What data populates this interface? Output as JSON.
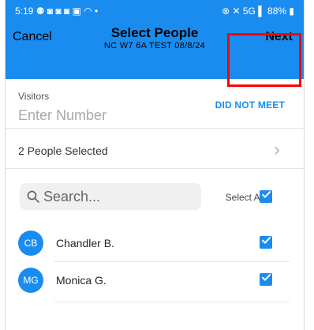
{
  "status_bar": {
    "time": "5:19",
    "left_icons": "⚉ ◙ ◙ ◙ ▣ ◠ •",
    "right_text": "⊗ ✕ 5G ▌ 88% ▮"
  },
  "header": {
    "cancel_label": "Cancel",
    "title": "Select People",
    "subtitle": "NC W7 6A TEST 08/8/24",
    "next_label": "Next"
  },
  "visitors": {
    "label": "Visitors",
    "placeholder": "Enter Number",
    "did_not_meet_label": "DID NOT MEET"
  },
  "selection": {
    "summary": "2 People Selected",
    "chevron": "›"
  },
  "search": {
    "placeholder": "Search...",
    "select_all_label": "Select All",
    "select_all_checked": true
  },
  "people": [
    {
      "initials": "CB",
      "name": "Chandler B.",
      "checked": true
    },
    {
      "initials": "MG",
      "name": "Monica G.",
      "checked": true
    }
  ],
  "colors": {
    "accent": "#1a8cf0",
    "highlight": "#ff0000"
  },
  "icons": {
    "search": "search-icon",
    "check": "check-icon",
    "chevron": "chevron-right-icon"
  }
}
